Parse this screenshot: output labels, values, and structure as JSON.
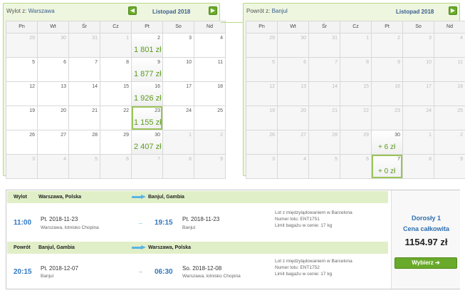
{
  "outbound_calendar": {
    "header_label": "Wylot z:",
    "header_city": "Warszawa",
    "month": "Listopad 2018",
    "prev_icon": "◀",
    "next_icon": "▶",
    "weekdays": [
      "Pn",
      "Wt",
      "Śr",
      "Cz",
      "Pt",
      "So",
      "Nd"
    ],
    "days": [
      {
        "d": "29",
        "other": true
      },
      {
        "d": "30",
        "other": true
      },
      {
        "d": "31",
        "other": true
      },
      {
        "d": "1",
        "other": true
      },
      {
        "d": "2",
        "price": "1 801 zł"
      },
      {
        "d": "3"
      },
      {
        "d": "4"
      },
      {
        "d": "5"
      },
      {
        "d": "6"
      },
      {
        "d": "7"
      },
      {
        "d": "8"
      },
      {
        "d": "9",
        "price": "1 877 zł"
      },
      {
        "d": "10"
      },
      {
        "d": "11"
      },
      {
        "d": "12"
      },
      {
        "d": "13"
      },
      {
        "d": "14"
      },
      {
        "d": "15"
      },
      {
        "d": "16",
        "price": "1 926 zł"
      },
      {
        "d": "17"
      },
      {
        "d": "18"
      },
      {
        "d": "19"
      },
      {
        "d": "20"
      },
      {
        "d": "21"
      },
      {
        "d": "22"
      },
      {
        "d": "23",
        "price": "1 155 zł",
        "selected": true
      },
      {
        "d": "24"
      },
      {
        "d": "25"
      },
      {
        "d": "26"
      },
      {
        "d": "27"
      },
      {
        "d": "28"
      },
      {
        "d": "29"
      },
      {
        "d": "30",
        "price": "2 407 zł"
      },
      {
        "d": "1",
        "other": true
      },
      {
        "d": "2",
        "other": true
      },
      {
        "d": "3",
        "other": true
      },
      {
        "d": "4",
        "other": true
      },
      {
        "d": "5",
        "other": true
      },
      {
        "d": "6",
        "other": true
      },
      {
        "d": "7",
        "other": true
      },
      {
        "d": "8",
        "other": true
      },
      {
        "d": "9",
        "other": true
      }
    ]
  },
  "return_calendar": {
    "header_label": "Powrót z:",
    "header_city": "Banjul",
    "month": "Listopad 2018",
    "prev_icon": "◀",
    "next_icon": "▶",
    "weekdays": [
      "Pn",
      "Wt",
      "Śr",
      "Cz",
      "Pt",
      "So",
      "Nd"
    ],
    "days": [
      {
        "d": "29",
        "other": true
      },
      {
        "d": "30",
        "other": true
      },
      {
        "d": "31",
        "other": true
      },
      {
        "d": "1",
        "other": true
      },
      {
        "d": "2",
        "other": true
      },
      {
        "d": "3",
        "other": true
      },
      {
        "d": "4",
        "other": true
      },
      {
        "d": "5",
        "other": true
      },
      {
        "d": "6",
        "other": true
      },
      {
        "d": "7",
        "other": true
      },
      {
        "d": "8",
        "other": true
      },
      {
        "d": "9",
        "other": true
      },
      {
        "d": "10",
        "other": true
      },
      {
        "d": "11",
        "other": true
      },
      {
        "d": "12",
        "other": true
      },
      {
        "d": "13",
        "other": true
      },
      {
        "d": "14",
        "other": true
      },
      {
        "d": "15",
        "other": true
      },
      {
        "d": "16",
        "other": true
      },
      {
        "d": "17",
        "other": true
      },
      {
        "d": "18",
        "other": true
      },
      {
        "d": "19",
        "other": true
      },
      {
        "d": "20",
        "other": true
      },
      {
        "d": "21",
        "other": true
      },
      {
        "d": "22",
        "other": true
      },
      {
        "d": "23",
        "other": true
      },
      {
        "d": "24",
        "other": true
      },
      {
        "d": "25",
        "other": true
      },
      {
        "d": "26",
        "other": true
      },
      {
        "d": "27",
        "other": true
      },
      {
        "d": "28",
        "other": true
      },
      {
        "d": "29",
        "other": true
      },
      {
        "d": "30",
        "price": "+ 6 zł",
        "small": true
      },
      {
        "d": "1",
        "other": true
      },
      {
        "d": "2",
        "other": true
      },
      {
        "d": "3",
        "other": true
      },
      {
        "d": "4",
        "other": true
      },
      {
        "d": "5",
        "other": true
      },
      {
        "d": "6",
        "other": true
      },
      {
        "d": "7",
        "price": "+ 0 zł",
        "small": true,
        "selected": true
      },
      {
        "d": "8",
        "other": true
      },
      {
        "d": "9",
        "other": true
      }
    ]
  },
  "summary": {
    "outbound": {
      "label": "Wylot",
      "from": "Warszawa, Polska",
      "to": "Banjul, Gambia",
      "dep_time": "11:00",
      "dep_date": "Pt. 2018-11-23",
      "dep_place": "Warszawa, lotnisko Chopina",
      "arr_time": "19:15",
      "arr_date": "Pt. 2018-11-23",
      "arr_place": "Banjul",
      "info1": "Lot z międzylądowaniem w Barcelona",
      "info2": "Numer lotu: ENT1751",
      "info3": "Limit bagażu w cenie: 17 kg"
    },
    "return": {
      "label": "Powrót",
      "from": "Banjul, Gambia",
      "to": "Warszawa, Polska",
      "dep_time": "20:15",
      "dep_date": "Pt. 2018-12-07",
      "dep_place": "Banjul",
      "arr_time": "06:30",
      "arr_date": "So. 2018-12-08",
      "arr_place": "Warszawa, lotnisko Chopina",
      "info1": "Lot z międzylądowaniem w Barcelona",
      "info2": "Numer lotu: ENT1752",
      "info3": "Limit bagażu w cenie: 17 kg"
    },
    "small_arrow": "→",
    "adult_label": "Dorosły 1",
    "total_label": "Cena całkowita",
    "total_price": "1154.97 zł",
    "select_button": "Wybierz",
    "select_icon": "➔"
  }
}
